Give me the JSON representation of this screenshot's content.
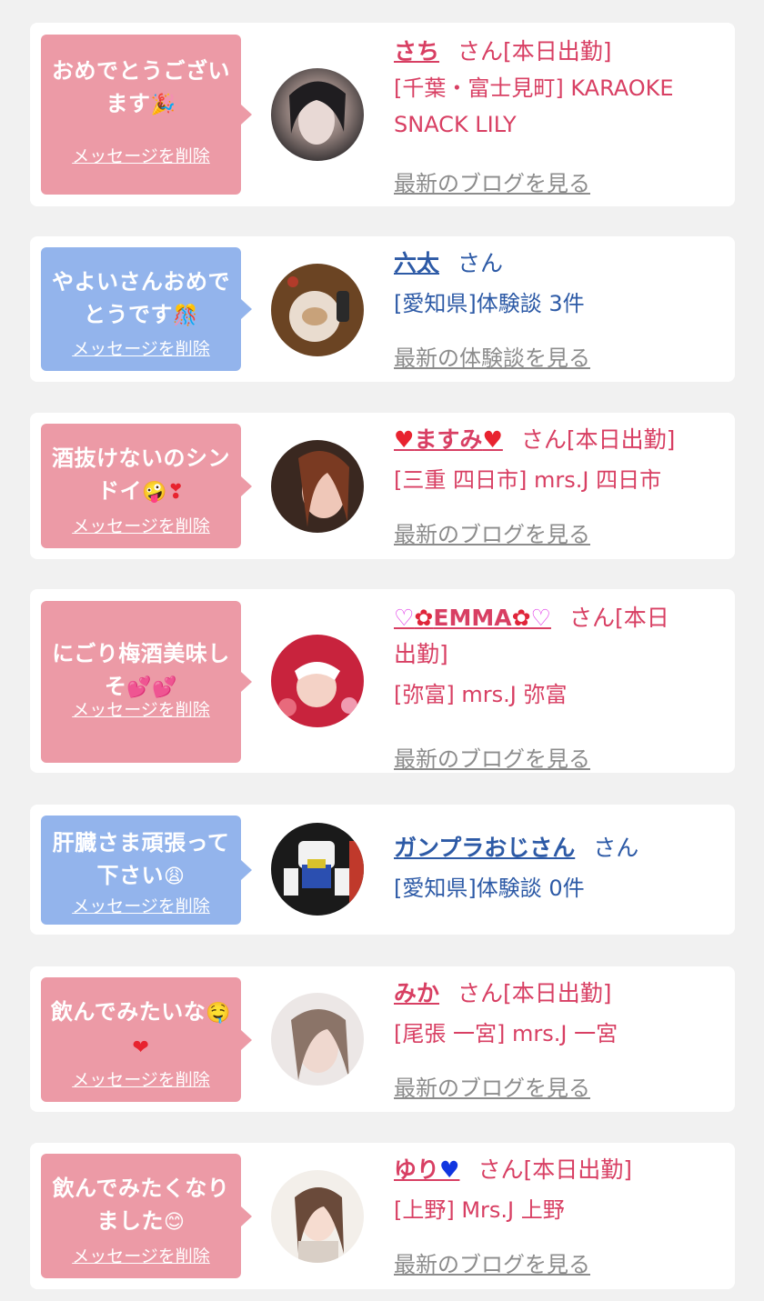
{
  "delete_label": "メッセージを削除",
  "colors": {
    "pink_bubble": "#ec9aa6",
    "blue_bubble": "#93b4ec",
    "pink_text": "#d83f63",
    "blue_text": "#2d5aa6"
  },
  "cards": [
    {
      "message_line1": "おめでとうござい",
      "message_line2": "ます",
      "message_emoji": "🎉",
      "name": "さち",
      "name_suffix": "さん[本日出勤]",
      "location_line1": "[千葉・富士見町] KARAOKE",
      "location_line2": "SNACK LILY",
      "latest_link": "最新のブログを見る"
    },
    {
      "message_line1": "やよいさんおめで",
      "message_line2": "とうです",
      "message_emoji": "🎊",
      "name": "六太",
      "name_suffix": "さん",
      "location_line1": "[愛知県]体験談 3件",
      "latest_link": "最新の体験談を見る"
    },
    {
      "message_line1": "酒抜けないのシン",
      "message_line2": "ドイ",
      "message_emoji": "🤪❣",
      "name": "ますみ",
      "name_suffix": "さん[本日出勤]",
      "location_line1": "[三重 四日市] mrs.J 四日市",
      "latest_link": "最新のブログを見る"
    },
    {
      "message_line1": "にごり梅酒美味し",
      "message_line2": "そ",
      "message_emoji": "💕💕",
      "name": "EMMA",
      "name_suffix": "さん[本日",
      "name_suffix2": "出勤]",
      "location_line1": "[弥富] mrs.J 弥富",
      "latest_link": "最新のブログを見る"
    },
    {
      "message_line1": "肝臓さま頑張って",
      "message_line2": "下さい",
      "message_emoji": "😩",
      "name": "ガンプラおじさん",
      "name_suffix": "さん",
      "location_line1": "[愛知県]体験談 0件"
    },
    {
      "message_line1": "飲んでみたいな",
      "message_line2": "",
      "message_emoji": "🤤",
      "message_emoji2": "❤",
      "name": "みか",
      "name_suffix": "さん[本日出勤]",
      "location_line1": "[尾張 一宮] mrs.J 一宮",
      "latest_link": "最新のブログを見る"
    },
    {
      "message_line1": "飲んでみたくなり",
      "message_line2": "ました",
      "message_emoji": "😊",
      "name": "ゆり",
      "name_suffix": "さん[本日出勤]",
      "location_line1": "[上野] Mrs.J 上野",
      "latest_link": "最新のブログを見る"
    }
  ]
}
